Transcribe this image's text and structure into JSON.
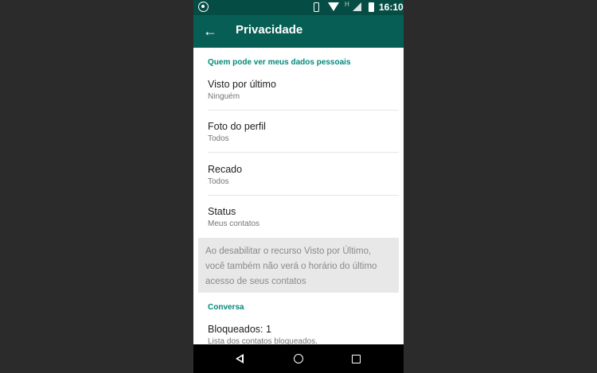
{
  "status_bar": {
    "time": "16:10",
    "network_label": "H",
    "icons": [
      "whatsapp-icon",
      "vibrate-icon",
      "wifi-icon",
      "signal-icon",
      "battery-icon"
    ]
  },
  "app_bar": {
    "back_icon": "arrow-left-icon",
    "title": "Privacidade"
  },
  "sections": [
    {
      "header": "Quem pode ver meus dados pessoais",
      "items": [
        {
          "title": "Visto por último",
          "subtitle": "Ninguém"
        },
        {
          "title": "Foto do perfil",
          "subtitle": "Todos"
        },
        {
          "title": "Recado",
          "subtitle": "Todos"
        },
        {
          "title": "Status",
          "subtitle": "Meus contatos"
        }
      ],
      "note_lines": [
        "Ao desabilitar o recurso Visto por Último,",
        "você também não verá o horário do último",
        "acesso de seus contatos"
      ]
    },
    {
      "header": "Conversa",
      "items": [
        {
          "title": "Bloqueados: 1",
          "subtitle": "Lista dos contatos bloqueados."
        }
      ]
    }
  ],
  "nav_bar": {
    "icons": [
      "back-triangle-icon",
      "home-circle-icon",
      "recents-square-icon"
    ]
  },
  "colors": {
    "status_bar": "#054d44",
    "app_bar": "#075e54",
    "accent": "#00897b",
    "note_background": "#e8e8e8",
    "outer_background": "#2b2b2b"
  }
}
